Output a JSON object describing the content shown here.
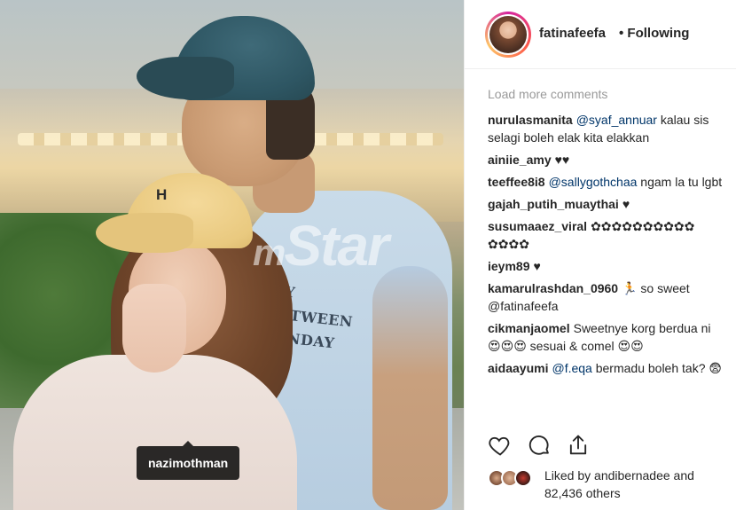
{
  "post": {
    "username": "fatinafeefa",
    "follow_state": "• Following",
    "photo_tag": "nazimothman",
    "watermark": "mStar",
    "shirt_text": "MY BETWEEN\nSUNDAY",
    "cap_letter": "H"
  },
  "comments_panel": {
    "load_more": "Load more comments",
    "comments": [
      {
        "user": "nurulasmanita",
        "mention": "@syaf_annuar",
        "text": " kalau sis selagi boleh elak kita elakkan"
      },
      {
        "user": "ainiie_amy",
        "mention": "",
        "text": "♥♥"
      },
      {
        "user": "teeffee8i8",
        "mention": "@sallygothchaa",
        "text": " ngam la tu lgbt"
      },
      {
        "user": "gajah_putih_muaythai",
        "mention": "",
        "text": "♥"
      },
      {
        "user": "susumaaez_viral",
        "mention": "",
        "text": "✿✿✿✿✿✿✿✿✿✿ ✿✿✿✿"
      },
      {
        "user": "ieym89",
        "mention": "",
        "text": "♥"
      },
      {
        "user": "kamarulrashdan_0960",
        "mention": "",
        "text": "🏃 so sweet @fatinafeefa"
      },
      {
        "user": "cikmanjaomel",
        "mention": "",
        "text": "Sweetnye korg berdua ni 😍😍😍 sesuai & comel 😍😍"
      },
      {
        "user": "aidaayumi",
        "mention": "@f.eqa",
        "text": " bermadu boleh tak? 😨"
      }
    ]
  },
  "actions": {
    "like_icon": "heart-icon",
    "comment_icon": "comment-bubble-icon",
    "share_icon": "share-icon"
  },
  "likes": {
    "text": "Liked by andibernadee and 82,436 others"
  }
}
